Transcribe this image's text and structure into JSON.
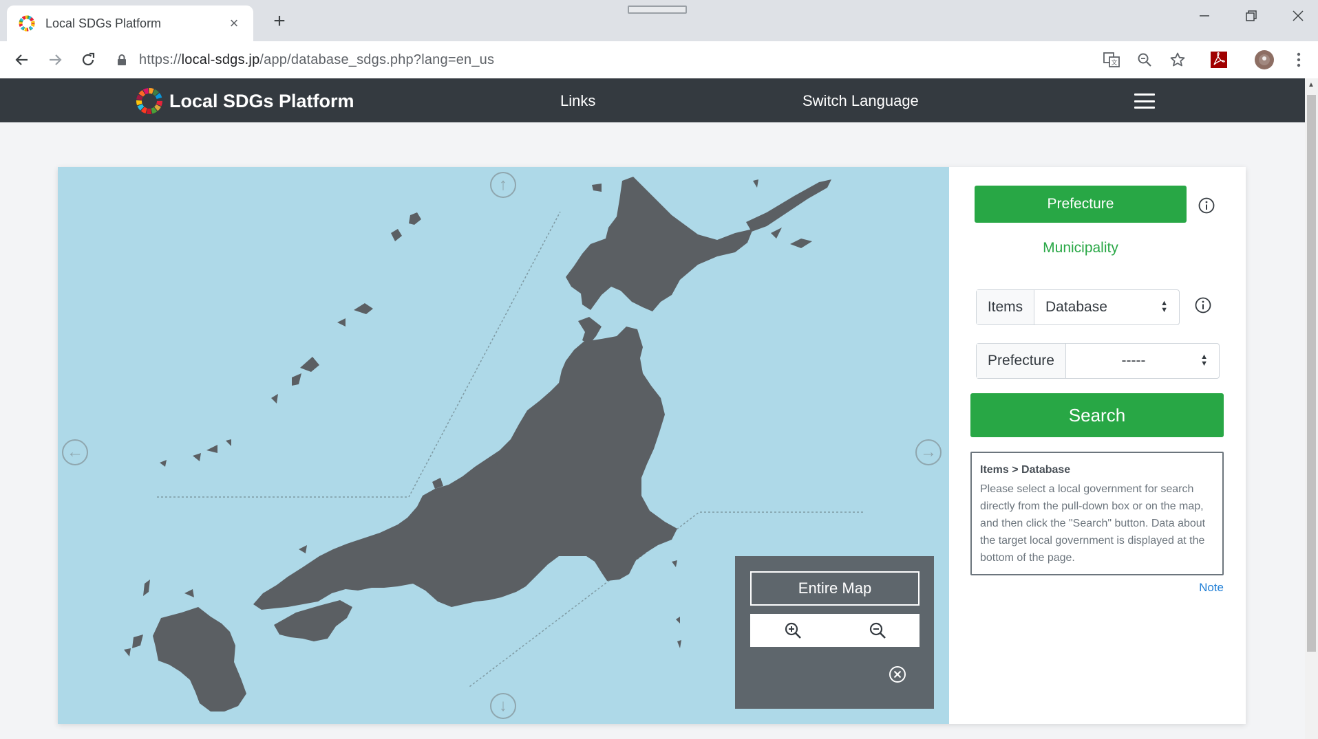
{
  "browser": {
    "tab_title": "Local SDGs Platform",
    "tab_close": "×",
    "new_tab": "+",
    "url_prefix": "https://",
    "url_host": "local-sdgs.jp",
    "url_path": "/app/database_sdgs.php?lang=en_us"
  },
  "site": {
    "brand": "Local SDGs Platform",
    "nav_links": [
      "Links",
      "Switch Language"
    ]
  },
  "map": {
    "entire_map_label": "Entire Map"
  },
  "panel": {
    "prefecture_button": "Prefecture",
    "municipality_link": "Municipality",
    "items_label": "Items",
    "items_value": "Database",
    "prefecture_label": "Prefecture",
    "prefecture_value": "-----",
    "search_button": "Search",
    "help_title": "Items > Database",
    "help_text": "Please select a local government for search directly from the pull-down box or on the map, and then click the \"Search\" button. Data about the target local government is displayed at the bottom of the page.",
    "note_link": "Note"
  },
  "colors": {
    "nav_bg": "#343a40",
    "success": "#28a745",
    "map_sea": "#aed9e8",
    "map_land": "#5b5f63",
    "link": "#1e7ed6"
  },
  "icons": [
    "back-icon",
    "forward-icon",
    "reload-icon",
    "lock-icon",
    "translate-icon",
    "zoom-icon",
    "star-icon",
    "pdf-icon",
    "avatar",
    "menu-icon",
    "info-icon",
    "zoom-in-icon",
    "zoom-out-icon",
    "close-icon"
  ]
}
